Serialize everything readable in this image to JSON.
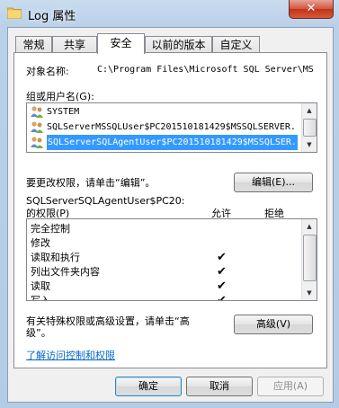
{
  "window": {
    "title": "Log 属性",
    "close_glyph": "✕"
  },
  "tabs": [
    {
      "label": "常规"
    },
    {
      "label": "共享"
    },
    {
      "label": "安全"
    },
    {
      "label": "以前的版本"
    },
    {
      "label": "自定义"
    }
  ],
  "security": {
    "object_name_label": "对象名称:",
    "object_name_value": "C:\\Program Files\\Microsoft SQL Server\\MS",
    "groups_label": "组或用户名(G):",
    "users": [
      {
        "name": "SYSTEM",
        "icon": "users-group-icon"
      },
      {
        "name": "SQLServerMSSQLUser$PC201510181429$MSSQLSERVER.",
        "icon": "users-group-icon"
      },
      {
        "name": "SQLServerSQLAgentUser$PC201510181429$MSSQLSER.",
        "icon": "users-group-icon",
        "selected": true
      }
    ],
    "edit_hint": "要更改权限，请单击“编辑”。",
    "edit_button": "编辑(E)...",
    "perm_for_line1": "SQLServerSQLAgentUser$PC20:",
    "perm_for_line2": "的权限(P)",
    "allow_header": "允许",
    "deny_header": "拒绝",
    "permissions": [
      {
        "name": "完全控制",
        "allow": false,
        "deny": false
      },
      {
        "name": "修改",
        "allow": false,
        "deny": false
      },
      {
        "name": "读取和执行",
        "allow": true,
        "deny": false
      },
      {
        "name": "列出文件夹内容",
        "allow": true,
        "deny": false
      },
      {
        "name": "读取",
        "allow": true,
        "deny": false
      },
      {
        "name": "写入",
        "allow": true,
        "deny": false
      }
    ],
    "check_glyph": "✔",
    "advanced_hint_line1": "有关特殊权限或高级设置，请单击“高",
    "advanced_hint_line2": "级”。",
    "advanced_button": "高级(V)",
    "learn_link": "了解访问控制和权限"
  },
  "footer": {
    "ok": "确定",
    "cancel": "取消",
    "apply": "应用(A)"
  },
  "colors": {
    "selection": "#3399ff",
    "link": "#0066cc"
  }
}
